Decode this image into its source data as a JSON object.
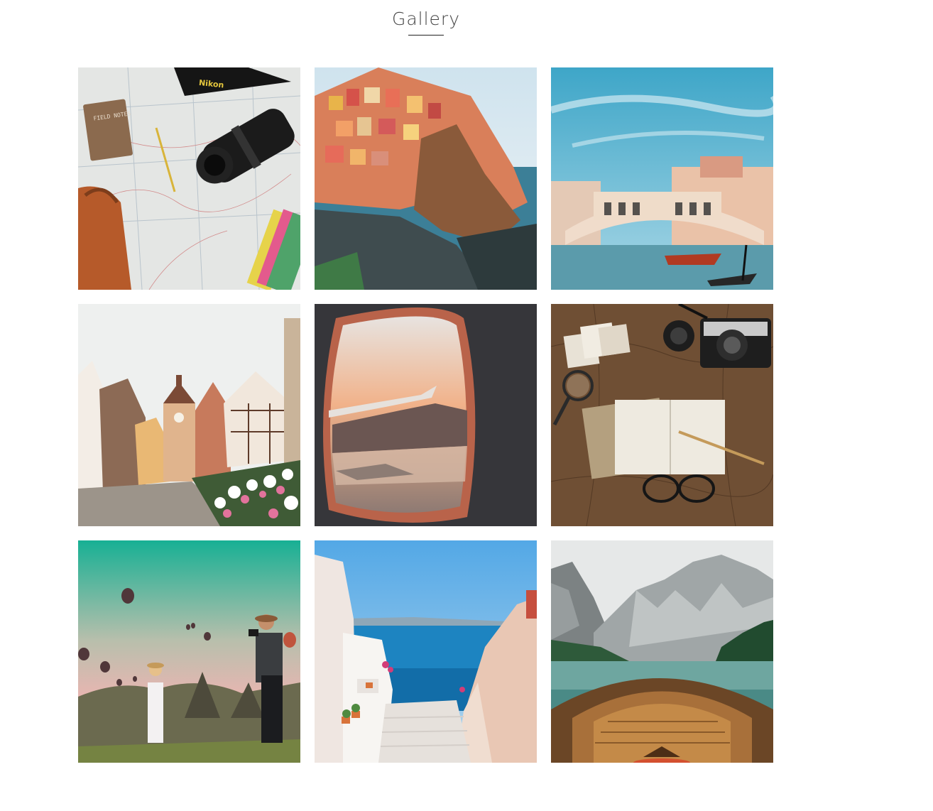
{
  "header": {
    "title": "Gallery"
  },
  "gallery": {
    "items": [
      {
        "subject": "travel-map-camera-flatlay",
        "map_label": "FIELD NOTES",
        "strap_label": "Nikon"
      },
      {
        "subject": "cliffside-village-sea"
      },
      {
        "subject": "canal-bridge-gondola"
      },
      {
        "subject": "half-timbered-street-clock-tower"
      },
      {
        "subject": "airplane-window-sunset"
      },
      {
        "subject": "vintage-map-camera-notebook"
      },
      {
        "subject": "hot-air-balloons-couple"
      },
      {
        "subject": "white-stairs-blue-sea"
      },
      {
        "subject": "wooden-boat-mountain-lake"
      }
    ]
  },
  "colors": {
    "background": "#ffffff",
    "title_text": "#444444",
    "underline": "#222222"
  }
}
